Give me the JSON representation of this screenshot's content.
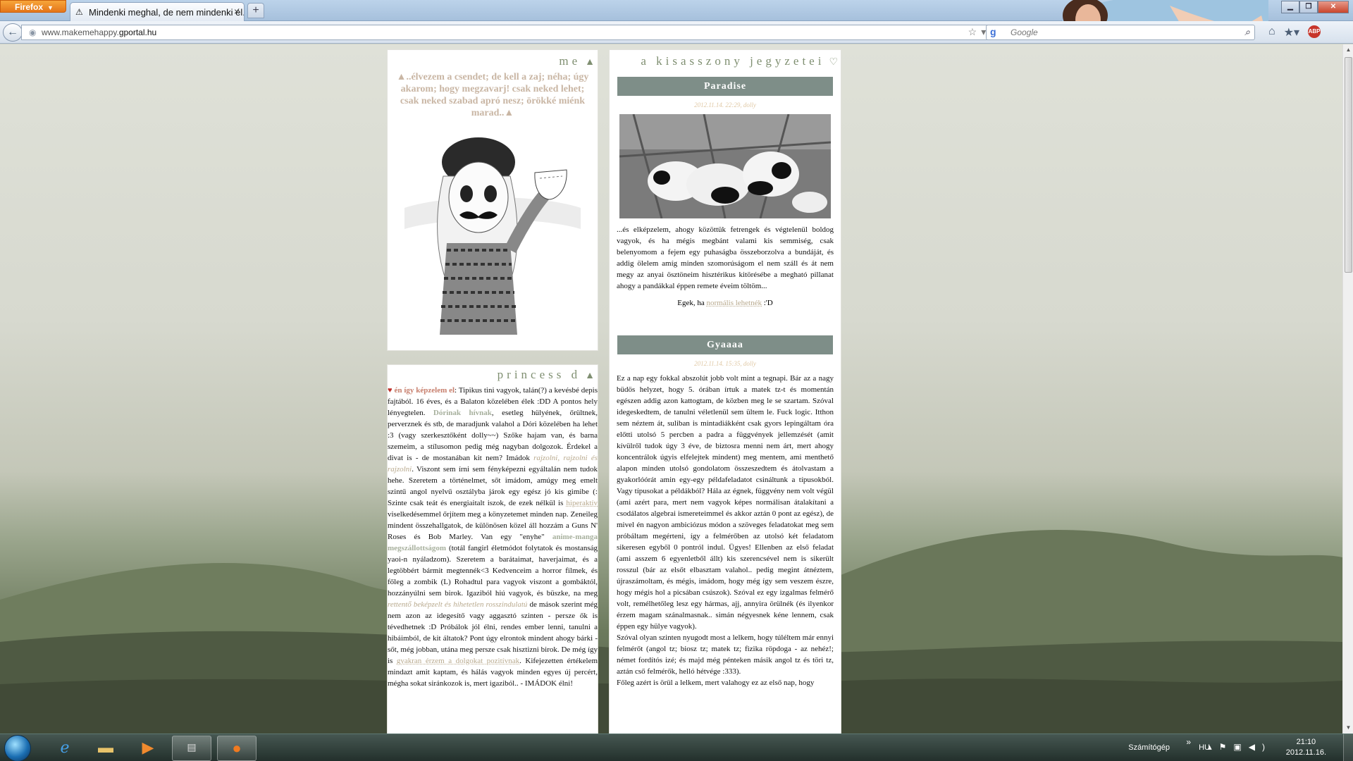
{
  "browser": {
    "app_button": "Firefox",
    "tab_title": "Mindenki meghal, de nem mindenki él. ...",
    "url_prefix": "www.makemehappy.",
    "url_domain": "gportal.hu",
    "search_placeholder": "Google",
    "search_engine_letter": "g"
  },
  "left": {
    "me_title": "me",
    "quote": "▲..élvezem a csendet; de kell a zaj; néha; úgy akarom; hogy megzavarj! csak neked lehet; csak neked szabad apró nesz; örökké miénk marad..▲",
    "princess_title": "princess d",
    "bio": {
      "p1_link": "én így képzelem el",
      "p1": ": Tipikus tini vagyok, talán(?) a kevésbé depis fajtából. 16 éves, és a Balaton közelében élek :DD A pontos hely lényegtelen. ",
      "p2_hl": "Dórinak hívnak",
      "p2": ", esetleg hülyének, őrültnek, perverznek és stb, de maradjunk valahol a Dóri közelében ha lehet :3 (vagy szerkesztőként dolly~~) Szőke hajam van, és barna szemeim, a stílusomon pedig még nagyban dolgozok. Érdekel a divat is - de mostanában kit nem? Imádok ",
      "p3_it": "rajzolni, rajzolni és rajzolni",
      "p3": ". Viszont sem írni sem fényképezni egyáltalán nem tudok hehe. Szeretem a történelmet, sőt imádom, amúgy meg emelt szintű angol nyelvű osztályba járok egy egész jó kis gimibe (: Szinte csak teát és energiaitalt iszok, de ezek nélkül is ",
      "p4_ul": "hiperaktív",
      "p4": " viselkedésemmel őrjítem meg a könyzetemet minden nap. Zeneileg mindent összehallgatok, de különösen közel áll hozzám a Guns N' Roses és Bob Marley. Van egy \"enyhe\" ",
      "p5_hl": "anime-manga megszállottságom",
      "p5": " (totál fangirl életmódot folytatok és mostanság yaoi-n nyáladzom). Szeretem a barátaimat, haverjaimat, és a legtöbbért bármit megtennék<3 Kedvenceim a horror filmek, és főleg a zombik (L) Rohadtul para vagyok viszont a gombáktól, hozzányúlni sem birok. Igaziból hiú vagyok, és büszke, na meg ",
      "p6_it": "rettentő beképzelt és hihetetlen rosszindulatú",
      "p6": " de mások szerint még nem azon az idegesítő vagy aggasztó szinten - persze ők is tévedhetnek :D Próbálok jól élni, rendes ember lenni, tanulni a hibáimból, de kit áltatok? Pont úgy elrontok mindent ahogy bárki - sőt, még jobban, utána meg persze csak hisztizni birok. De még így is ",
      "p7_ul": "gyakran érzem a dolgokat pozitívnak",
      "p7": ". Kifejezetten értékelem mindazt amit kaptam, és hálás vagyok minden egyes új percért, mégha sokat siránkozok is, mert igaziból.. - IMÁDOK élni!"
    }
  },
  "right": {
    "title": "a kisasszony jegyzetei",
    "post1": {
      "title": "Paradise",
      "date": "2012.11.14. 22:29, dolly",
      "text": "...és elképzelem, ahogy közöttük fetrengek és végtelenül boldog vagyok, és ha mégis megbánt valami kis semmiség, csak belenyomom a fejem egy puhaságba összeborzolva a bundáját, és addig ölelem amíg minden szomorúságom el nem száll és át nem megy az anyai ösztöneim hisztérikus kitörésébe a megható pillanat ahogy a pandákkal éppen remete éveim töltöm...",
      "footer_pre": "Egek, ha ",
      "footer_link": "normális lehetnék",
      "footer_post": " :'D"
    },
    "post2": {
      "title": "Gyaaaa",
      "date": "2012.11.14. 15:35, dolly",
      "text": "Ez a nap egy fokkal abszolút jobb volt mint a tegnapi. Bár az a nagy büdös helyzet, hogy 5. órában írtuk a matek tz-t és momentán egészen addig azon kattogtam, de közben meg le se szartam. Szóval idegeskedtem, de tanulni véletlenül sem ültem le. Fuck logic. Itthon sem néztem át, suliban is mintadiákként csak gyors lepingáltam óra előtti utolsó 5 percben a padra a függvények jellemzését (amit kívülről tudok úgy 3 éve, de biztosra menni nem árt, mert ahogy koncentrálok úgyis elfelejtek mindent) meg mentem, ami menthető alapon minden utolsó gondolatom összeszedtem és átolvastam a gyakorlóórát amin egy-egy példafeladatot csináltunk a típusokból. Vagy típusokat a példákból? Hála az égnek, függvény nem volt végül (ami azért para, mert nem vagyok képes normálisan átalakítani a csodálatos algebrai ismereteimmel és akkor aztán 0 pont az egész), de mivel én nagyon ambiciózus módon a szöveges feladatokat meg sem próbáltam megérteni, így a felmérőben az utolsó két feladatom sikeresen egyből 0 pontról indul. Ügyes! Ellenben az első feladat (ami asszem 6 egyenletből állt) kis szerencsével nem is sikerült rosszul (bár az elsőt elbasztam valahol.. pedig megint átnéztem, újraszámoltam, és mégis, imádom, hogy még így sem veszem észre, hogy mégis hol a picsában csúszok). Szóval ez egy izgalmas felmérő volt, remélhetőleg lesz egy hármas, ajj, annyira örülnék (és ilyenkor érzem magam szánalmasnak.. simán négyesnek kéne lennem, csak éppen egy hülye vagyok).",
      "text2": "Szóval olyan szinten nyugodt most a lelkem, hogy túléltem már ennyi felmérőt (angol tz; biosz tz; matek tz; fizika röpdoga - az nehéz!; német fordítós izé; és majd még pénteken másik angol tz és töri tz, aztán cső felmérők, helló hétvége :333).",
      "text3": "Főleg azért is örül a lelkem, mert valahogy ez az első nap, hogy"
    }
  },
  "taskbar": {
    "computer_label": "Számítógép",
    "language": "HU",
    "time": "21:10",
    "date": "2012.11.16."
  },
  "colors": {
    "title_green": "#7f8f71",
    "post_header": "#7e8e88",
    "quote_pink": "#c9b6a4",
    "date_peach": "#e0c9a6"
  },
  "icons": [
    "warning-icon",
    "close-icon",
    "plus-icon",
    "back-arrow-icon",
    "globe-icon",
    "star-icon",
    "reload-icon",
    "search-icon",
    "home-icon",
    "bookmarks-icon",
    "adblock-icon",
    "heart-icon",
    "triangle-icon",
    "start-orb-icon",
    "internet-explorer-icon",
    "folder-icon",
    "media-player-icon",
    "chrome-app-icon",
    "firefox-icon",
    "flag-icon",
    "network-icon",
    "volume-icon"
  ]
}
